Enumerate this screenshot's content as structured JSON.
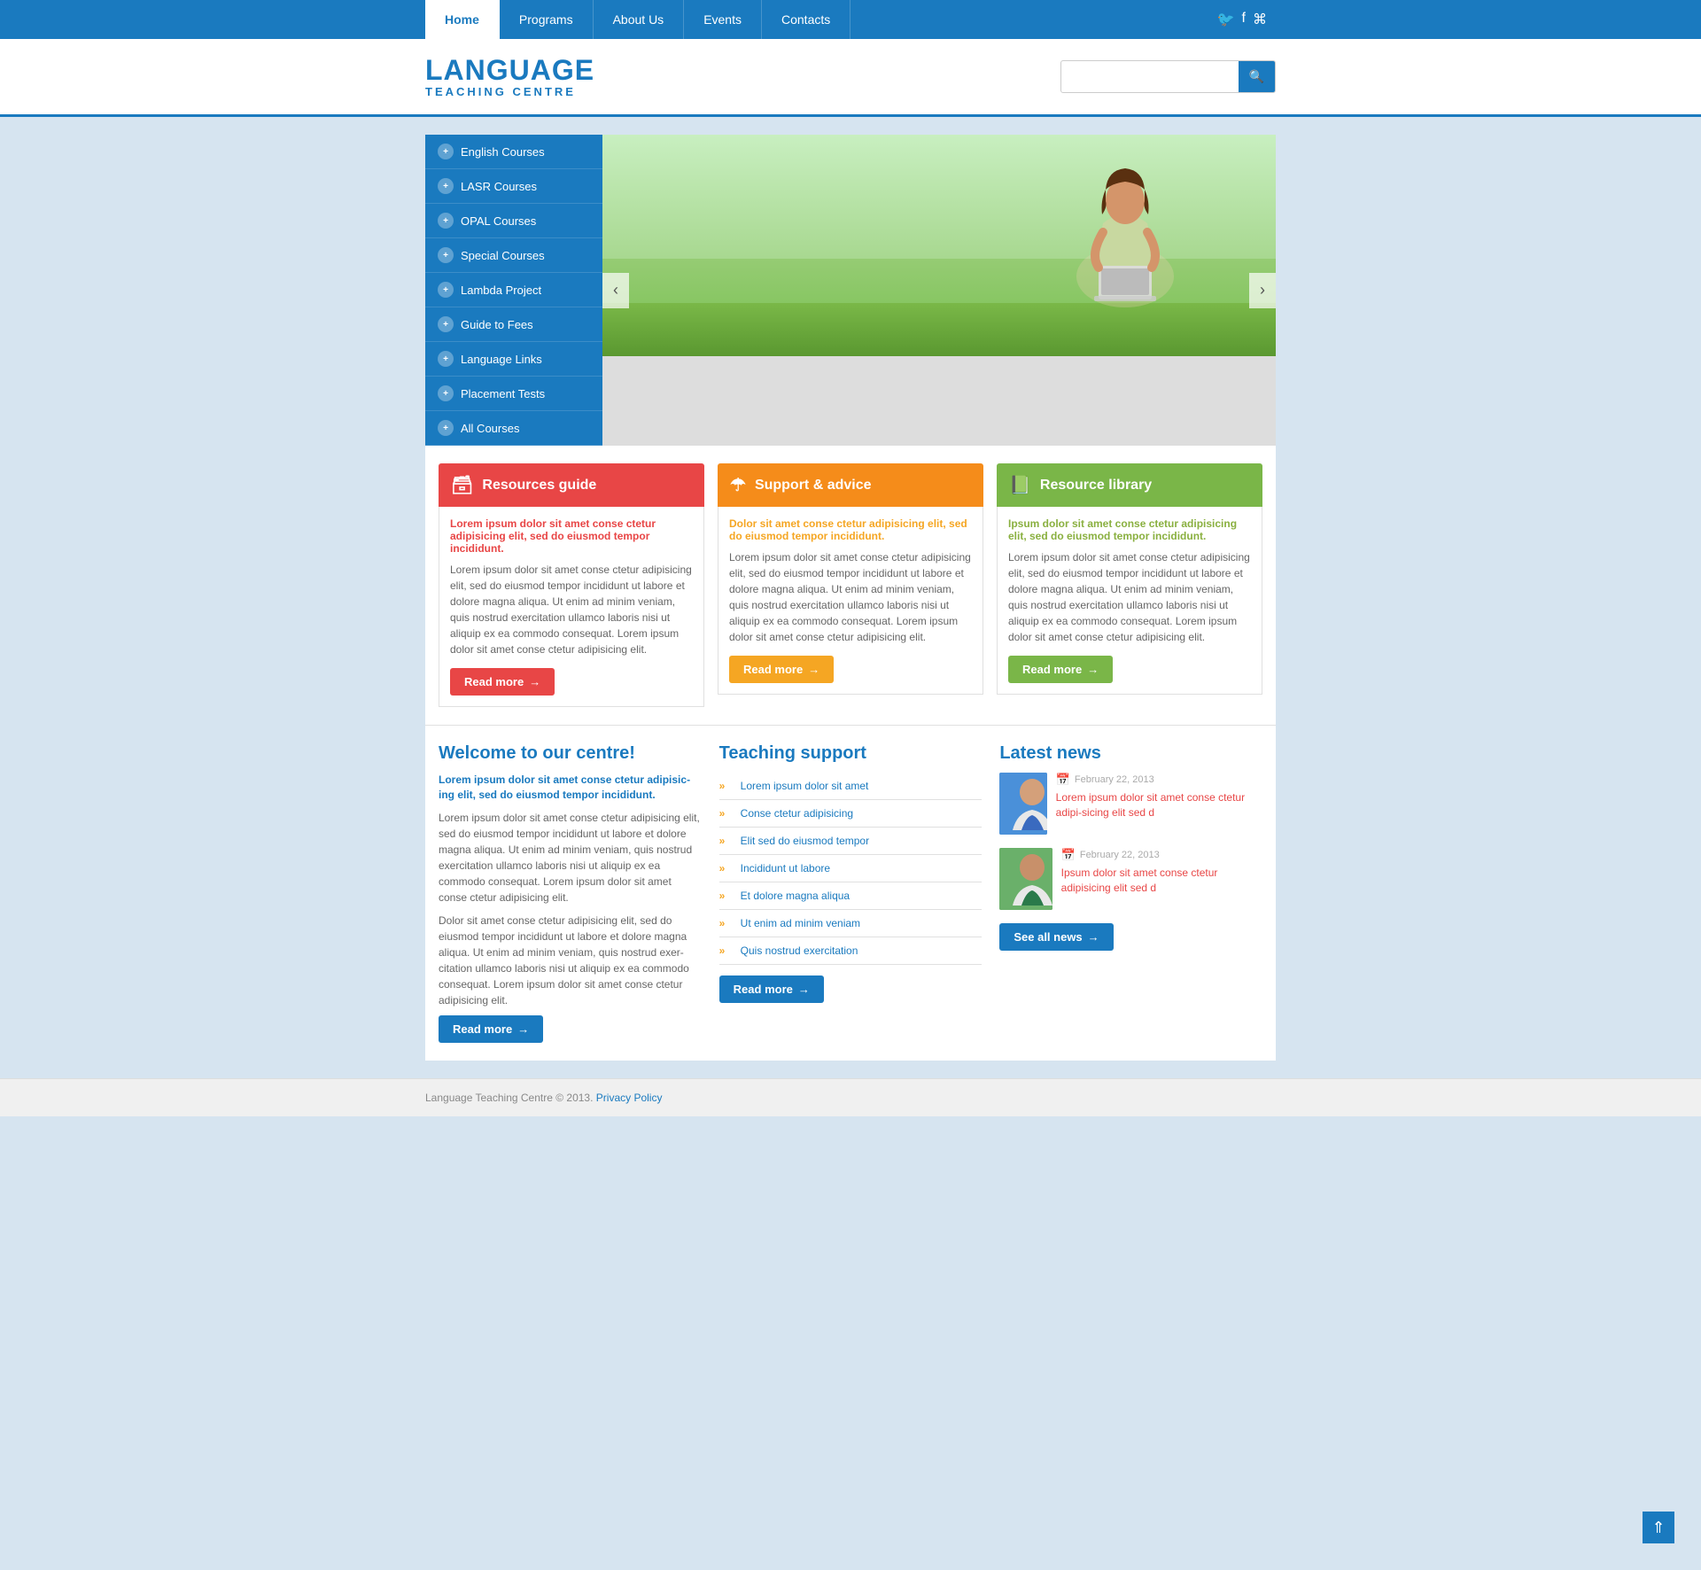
{
  "nav": {
    "items": [
      {
        "label": "Home",
        "active": true
      },
      {
        "label": "Programs",
        "active": false
      },
      {
        "label": "About Us",
        "active": false
      },
      {
        "label": "Events",
        "active": false
      },
      {
        "label": "Contacts",
        "active": false
      }
    ],
    "social": [
      "𝕏",
      "f",
      "RSS"
    ]
  },
  "header": {
    "logo_main": "LANGUAGE",
    "logo_sub": "TEACHING CENTRE",
    "search_placeholder": ""
  },
  "sidebar": {
    "items": [
      "English Courses",
      "LASR Courses",
      "OPAL Courses",
      "Special Courses",
      "Lambda Project",
      "Guide to Fees",
      "Language Links",
      "Placement Tests",
      "All Courses"
    ]
  },
  "slider": {
    "prev": "‹",
    "next": "›"
  },
  "info_boxes": [
    {
      "title": "Resources guide",
      "color": "red",
      "icon": "🗃",
      "highlight": "Lorem ipsum dolor sit amet conse ctetur adipisicing elit, sed do eiusmod tempor incididunt.",
      "text": "Lorem ipsum dolor sit amet conse ctetur adipisicing elit, sed do eiusmod tempor incididunt ut labore et dolore magna aliqua. Ut enim ad minim veniam, quis nostrud exercitation ullamco laboris nisi ut aliquip ex ea commodo consequat. Lorem ipsum dolor sit amet conse ctetur adipisicing elit.",
      "btn": "Read more"
    },
    {
      "title": "Support & advice",
      "color": "orange",
      "icon": "☂",
      "highlight": "Dolor sit amet conse ctetur adipisicing elit, sed do eiusmod tempor incididunt.",
      "text": "Lorem ipsum dolor sit amet conse ctetur adipisicing elit, sed do eiusmod tempor incididunt ut labore et dolore magna aliqua. Ut enim ad minim veniam, quis nostrud exercitation ullamco laboris nisi ut aliquip ex ea commodo consequat. Lorem ipsum dolor sit amet conse ctetur adipisicing elit.",
      "btn": "Read more"
    },
    {
      "title": "Resource library",
      "color": "green",
      "icon": "📗",
      "highlight": "Ipsum dolor sit amet conse ctetur adipisicing elit, sed do eiusmod tempor incididunt.",
      "text": "Lorem ipsum dolor sit amet conse ctetur adipisicing elit, sed do eiusmod tempor incididunt ut labore et dolore magna aliqua. Ut enim ad minim veniam, quis nostrud exercitation ullamco laboris nisi ut aliquip ex ea commodo consequat. Lorem ipsum dolor sit amet conse ctetur adipisicing elit.",
      "btn": "Read more"
    }
  ],
  "welcome": {
    "title": "Welcome to our centre!",
    "highlight": "Lorem ipsum dolor sit amet conse ctetur adipisic-ing elit, sed do eiusmod tempor incididunt.",
    "text1": "Lorem ipsum dolor sit amet conse ctetur adipisicing elit, sed do eiusmod tempor incididunt ut labore et dolore magna aliqua. Ut enim ad minim veniam, quis nostrud exercitation ullamco laboris nisi ut aliquip ex ea commodo consequat. Lorem ipsum dolor sit amet conse ctetur adipisicing elit.",
    "text2": "Dolor sit amet conse ctetur adipisicing elit, sed do eiusmod tempor incididunt ut labore et dolore magna aliqua. Ut enim ad minim veniam, quis nostrud exer-citation ullamco laboris nisi ut aliquip ex ea commodo consequat. Lorem ipsum dolor sit amet conse ctetur adipisicing elit.",
    "btn": "Read more"
  },
  "teaching": {
    "title": "Teaching support",
    "items": [
      "Lorem ipsum dolor sit amet",
      "Conse ctetur adipisicing",
      "Elit sed do eiusmod tempor",
      "Incididunt ut labore",
      "Et dolore magna aliqua",
      "Ut enim ad minim veniam",
      "Quis nostrud exercitation"
    ],
    "btn": "Read more"
  },
  "news": {
    "title": "Latest news",
    "items": [
      {
        "date": "February 22, 2013",
        "title": "Lorem ipsum dolor sit amet conse ctetur adipi-sicing elit sed d",
        "img_type": "blue"
      },
      {
        "date": "February 22, 2013",
        "title": "Ipsum dolor sit amet conse ctetur adipisicing elit sed d",
        "img_type": "green"
      }
    ],
    "btn": "See all news"
  },
  "footer": {
    "copyright": "Language Teaching Centre © 2013.",
    "privacy_label": "Privacy Policy"
  },
  "scroll_top": "⇑"
}
